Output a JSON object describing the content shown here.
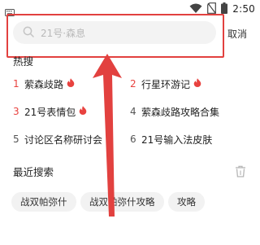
{
  "status_bar": {
    "time": "2:50",
    "left_icon": "keyboard-icon",
    "icons": [
      "wifi-icon",
      "no-sim-icon",
      "battery-icon"
    ]
  },
  "search": {
    "placeholder": "21号·森息",
    "cancel_label": "取消",
    "icon": "search-icon"
  },
  "hot": {
    "title": "热搜",
    "items": [
      {
        "rank": "1",
        "label": "萦森歧路",
        "hot": true,
        "rank_color": "#e8423f"
      },
      {
        "rank": "2",
        "label": "行星环游记",
        "hot": true,
        "rank_color": "#e8423f"
      },
      {
        "rank": "3",
        "label": "21号表情包",
        "hot": true,
        "rank_color": "#e8423f"
      },
      {
        "rank": "4",
        "label": "萦森歧路攻略合集",
        "hot": false,
        "rank_color": "#555555"
      },
      {
        "rank": "5",
        "label": "讨论区名称研讨会",
        "hot": false,
        "rank_color": "#555555"
      },
      {
        "rank": "6",
        "label": "21号输入法皮肤",
        "hot": false,
        "rank_color": "#555555"
      }
    ]
  },
  "recent": {
    "title": "最近搜索",
    "clear_icon": "trash-icon",
    "chips": [
      "战双帕弥什",
      "战双帕弥什攻略",
      "攻略"
    ]
  },
  "annotation": {
    "frame_color": "#e2413f",
    "arrow_color": "#e2413f"
  }
}
